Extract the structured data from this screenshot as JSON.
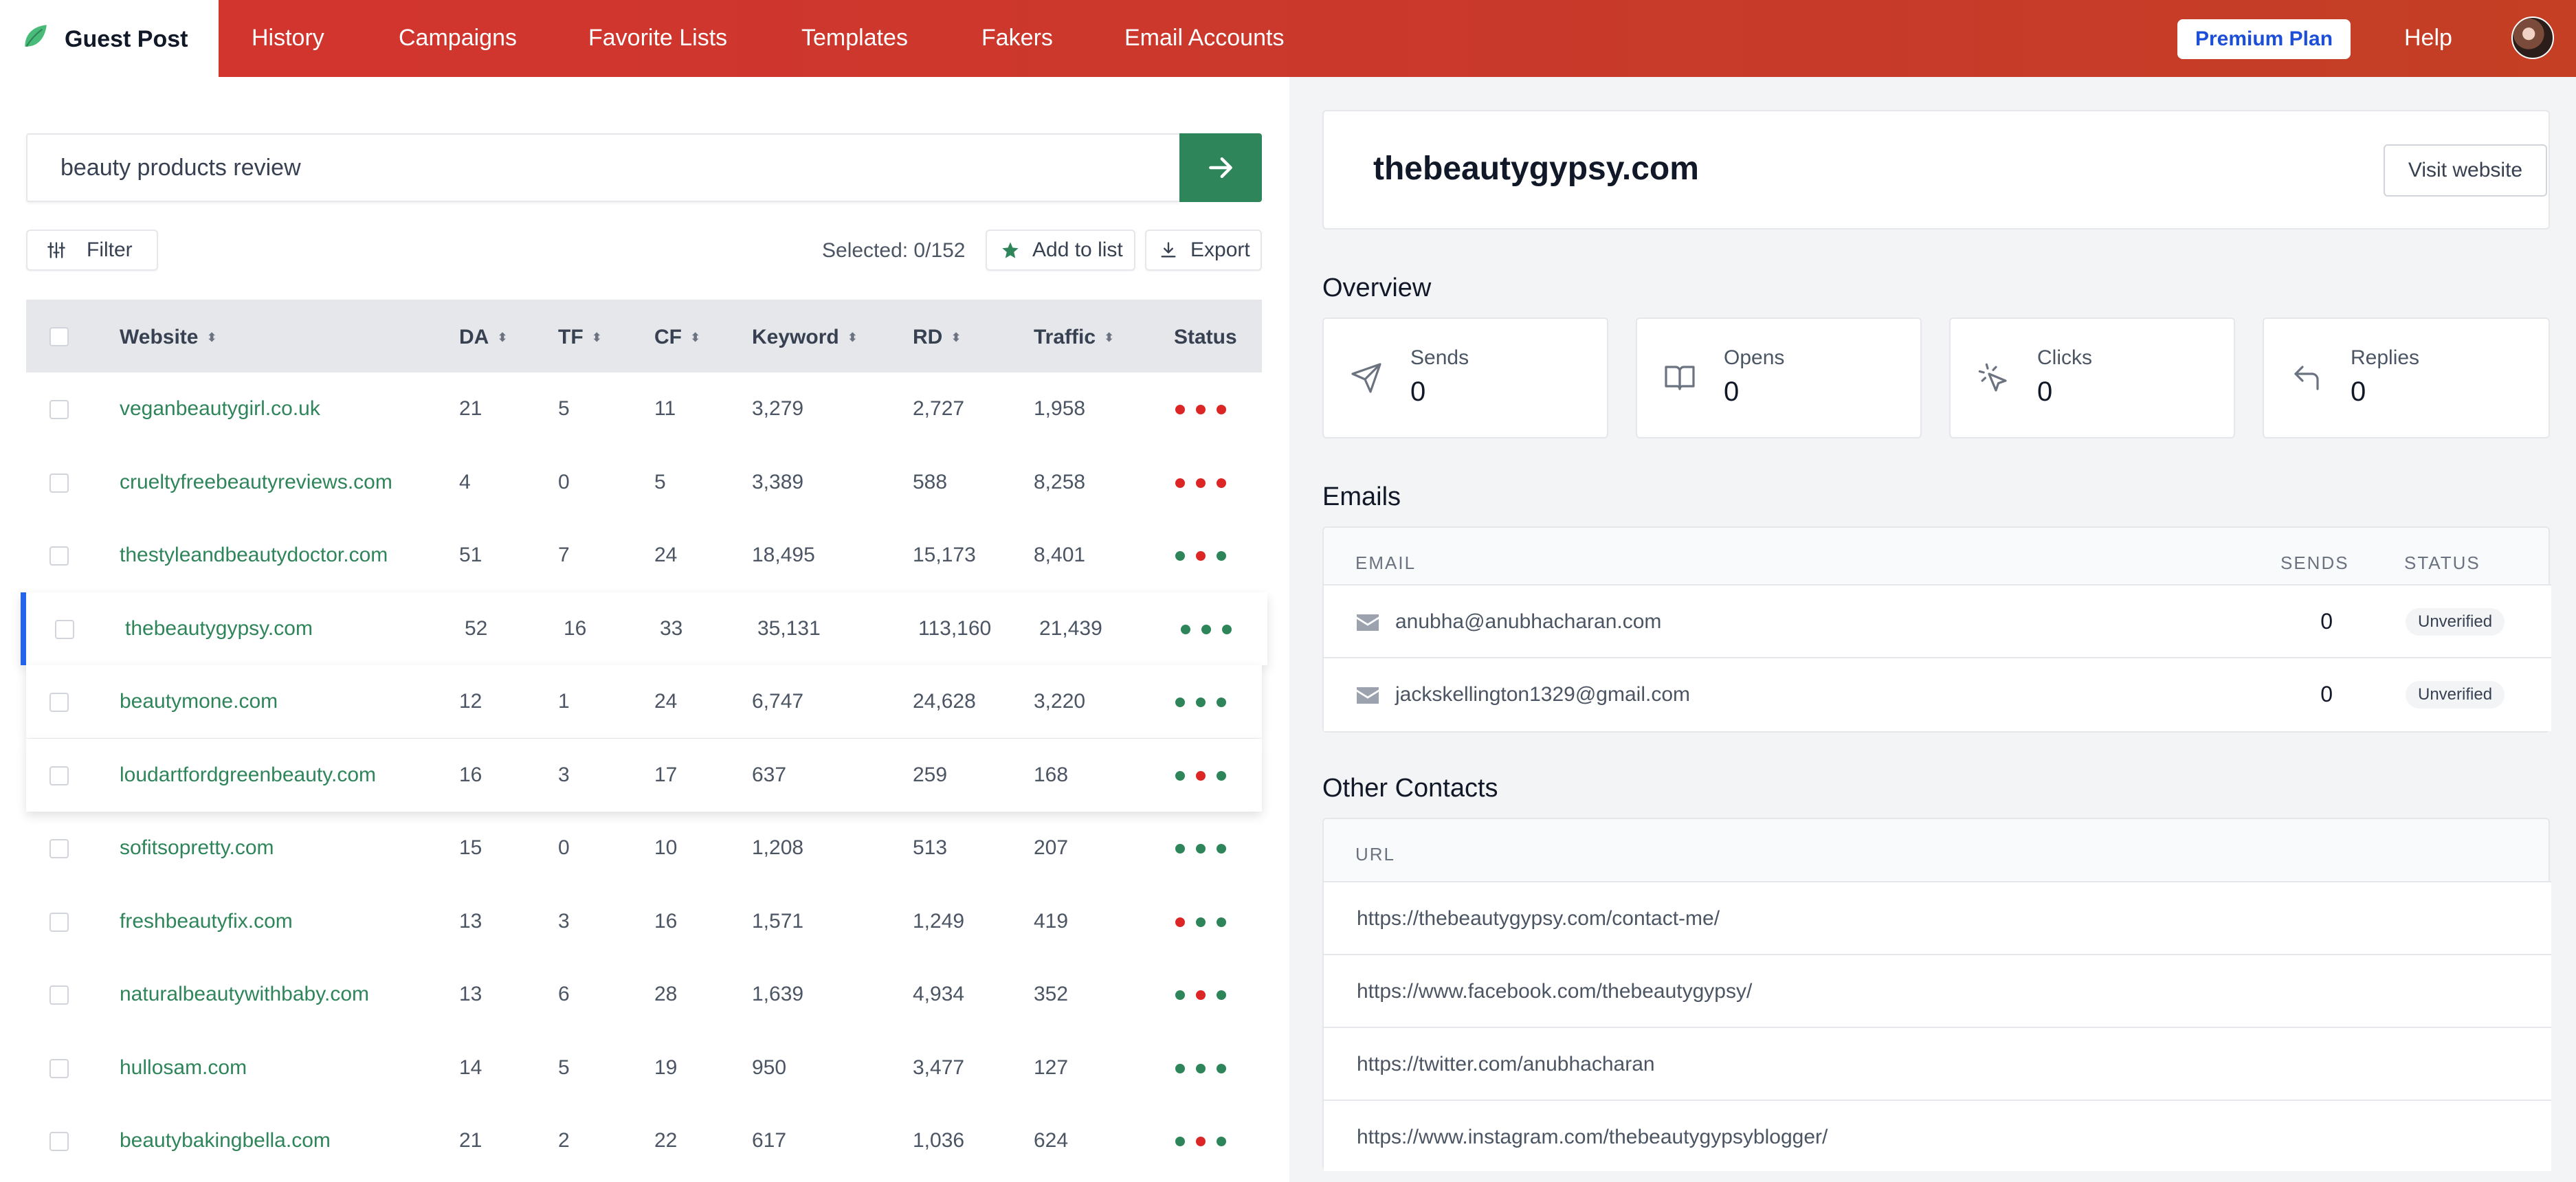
{
  "app": {
    "brand": "Guest Post"
  },
  "nav": {
    "items": [
      "History",
      "Campaigns",
      "Favorite Lists",
      "Templates",
      "Fakers",
      "Email Accounts"
    ],
    "premium": "Premium Plan",
    "help": "Help"
  },
  "search": {
    "query": "beauty products review"
  },
  "toolbar": {
    "filter": "Filter",
    "selected": "Selected: 0/152",
    "add_to_list": "Add to list",
    "export": "Export"
  },
  "table": {
    "headers": {
      "website": "Website",
      "da": "DA",
      "tf": "TF",
      "cf": "CF",
      "keyword": "Keyword",
      "rd": "RD",
      "traffic": "Traffic",
      "status": "Status"
    },
    "rows": [
      {
        "website": "veganbeautygirl.co.uk",
        "da": "21",
        "tf": "5",
        "cf": "11",
        "keyword": "3,279",
        "rd": "2,727",
        "traffic": "1,958",
        "status": [
          "red",
          "red",
          "red"
        ]
      },
      {
        "website": "crueltyfreebeautyreviews.com",
        "da": "4",
        "tf": "0",
        "cf": "5",
        "keyword": "3,389",
        "rd": "588",
        "traffic": "8,258",
        "status": [
          "red",
          "red",
          "red"
        ]
      },
      {
        "website": "thestyleandbeautydoctor.com",
        "da": "51",
        "tf": "7",
        "cf": "24",
        "keyword": "18,495",
        "rd": "15,173",
        "traffic": "8,401",
        "status": [
          "green",
          "red",
          "green"
        ]
      },
      {
        "website": "thebeautygypsy.com",
        "da": "52",
        "tf": "16",
        "cf": "33",
        "keyword": "35,131",
        "rd": "113,160",
        "traffic": "21,439",
        "status": [
          "green",
          "green",
          "green"
        ]
      },
      {
        "website": "beautymone.com",
        "da": "12",
        "tf": "1",
        "cf": "24",
        "keyword": "6,747",
        "rd": "24,628",
        "traffic": "3,220",
        "status": [
          "green",
          "green",
          "green"
        ]
      },
      {
        "website": "loudartfordgreenbeauty.com",
        "da": "16",
        "tf": "3",
        "cf": "17",
        "keyword": "637",
        "rd": "259",
        "traffic": "168",
        "status": [
          "green",
          "red",
          "green"
        ]
      },
      {
        "website": "sofitsopretty.com",
        "da": "15",
        "tf": "0",
        "cf": "10",
        "keyword": "1,208",
        "rd": "513",
        "traffic": "207",
        "status": [
          "green",
          "green",
          "green"
        ]
      },
      {
        "website": "freshbeautyfix.com",
        "da": "13",
        "tf": "3",
        "cf": "16",
        "keyword": "1,571",
        "rd": "1,249",
        "traffic": "419",
        "status": [
          "red",
          "green",
          "green"
        ]
      },
      {
        "website": "naturalbeautywithbaby.com",
        "da": "13",
        "tf": "6",
        "cf": "28",
        "keyword": "1,639",
        "rd": "4,934",
        "traffic": "352",
        "status": [
          "green",
          "red",
          "green"
        ]
      },
      {
        "website": "hullosam.com",
        "da": "14",
        "tf": "5",
        "cf": "19",
        "keyword": "950",
        "rd": "3,477",
        "traffic": "127",
        "status": [
          "green",
          "green",
          "green"
        ]
      },
      {
        "website": "beautybakingbella.com",
        "da": "21",
        "tf": "2",
        "cf": "22",
        "keyword": "617",
        "rd": "1,036",
        "traffic": "624",
        "status": [
          "green",
          "red",
          "green"
        ]
      }
    ]
  },
  "detail": {
    "site": "thebeautygypsy.com",
    "visit": "Visit website",
    "overview_title": "Overview",
    "stats": [
      {
        "label": "Sends",
        "value": "0",
        "icon": "send-icon"
      },
      {
        "label": "Opens",
        "value": "0",
        "icon": "book-open-icon"
      },
      {
        "label": "Clicks",
        "value": "0",
        "icon": "cursor-click-icon"
      },
      {
        "label": "Replies",
        "value": "0",
        "icon": "reply-icon"
      }
    ],
    "emails_title": "Emails",
    "emails_headers": {
      "email": "EMAIL",
      "sends": "SENDS",
      "status": "STATUS"
    },
    "emails": [
      {
        "email": "anubha@anubhacharan.com",
        "sends": "0",
        "status": "Unverified"
      },
      {
        "email": "jackskellington1329@gmail.com",
        "sends": "0",
        "status": "Unverified"
      }
    ],
    "contacts_title": "Other Contacts",
    "contacts_header": "URL",
    "contacts": [
      "https://thebeautygypsy.com/contact-me/",
      "https://www.facebook.com/thebeautygypsy/",
      "https://twitter.com/anubhacharan",
      "https://www.instagram.com/thebeautygypsyblogger/"
    ]
  },
  "colors": {
    "brand_red": "#d4342f",
    "green": "#2f855a",
    "status_red": "#dc2626",
    "status_green": "#2f855a",
    "active_blue": "#2563eb"
  }
}
